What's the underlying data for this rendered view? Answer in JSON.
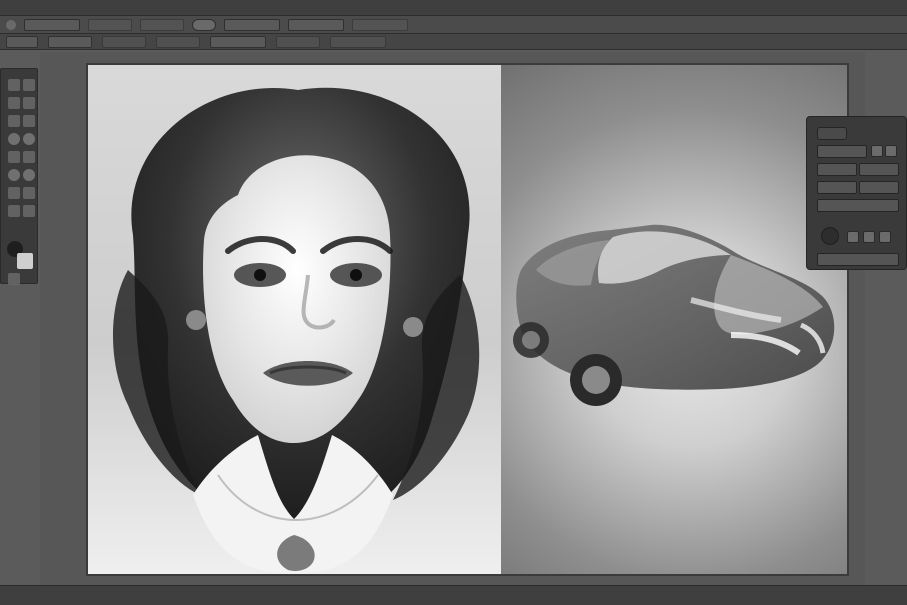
{
  "app": {
    "theme": {
      "bg": "#5b5b5b",
      "panel": "#3a3a3a",
      "border": "#2a2a2a",
      "text": "#d8d8d8"
    }
  },
  "menubar": {
    "items": [
      "",
      "",
      "",
      "",
      "",
      "",
      "",
      ""
    ]
  },
  "options_bar_1": {
    "fields": [
      "",
      "",
      "",
      "",
      "",
      ""
    ]
  },
  "options_bar_2": {
    "fields": [
      "",
      "",
      "",
      "",
      "",
      "",
      ""
    ]
  },
  "right_panel": {
    "tab_label": ""
  },
  "status": {
    "left_text": "",
    "right_text": ""
  },
  "icons": {
    "tool_brush": "brush-icon",
    "tool_eraser": "eraser-icon",
    "tool_move": "move-icon",
    "tool_zoom": "zoom-icon",
    "tool_color": "color-swatch-icon"
  }
}
